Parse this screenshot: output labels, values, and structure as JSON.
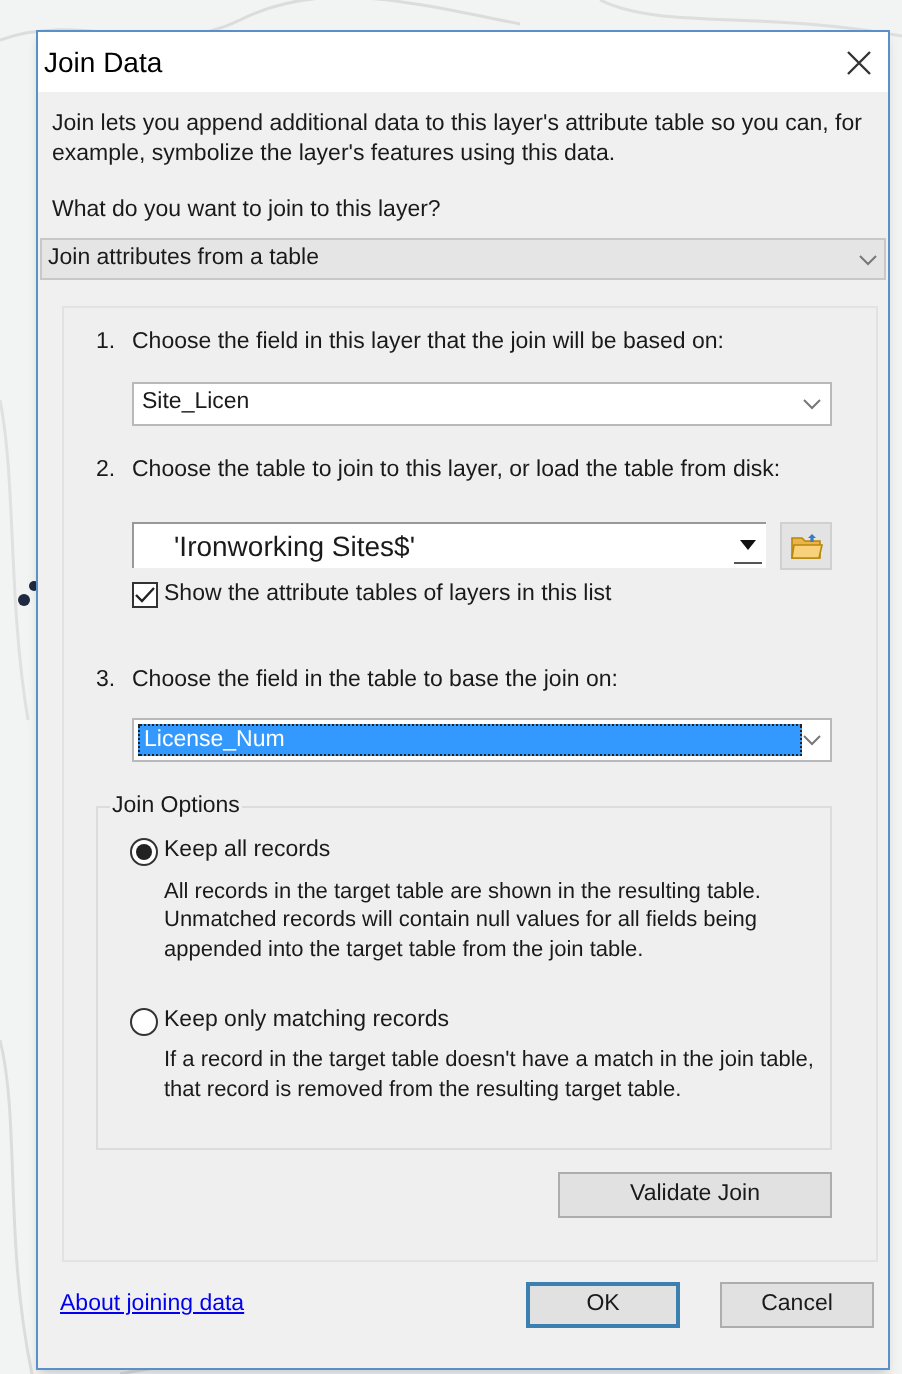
{
  "window": {
    "title": "Join Data"
  },
  "intro": "Join lets you append additional data to this layer's attribute table so you can, for example, symbolize the layer's features using this data.",
  "join_type": {
    "label": "What do you want to join to this layer?",
    "value": "Join attributes from a table"
  },
  "steps": [
    {
      "number": "1.",
      "label": "Choose the field in this layer that the join will be based on:",
      "kind": "dropdown",
      "value": "Site_Licen",
      "highlighted": false
    },
    {
      "number": "2.",
      "label": "Choose the table to join to this layer, or load the table from disk:",
      "kind": "table_picker",
      "value": "'Ironworking Sites$'",
      "checkbox": {
        "label": "Show the attribute tables of layers in this list",
        "checked": true
      }
    },
    {
      "number": "3.",
      "label": "Choose the field in the table to base the join on:",
      "kind": "dropdown",
      "value": "License_Num",
      "highlighted": true
    }
  ],
  "join_options": {
    "title": "Join Options",
    "options": [
      {
        "label": "Keep all records",
        "description": "All records in the target table are shown in the resulting table. Unmatched records will contain null values for all fields being appended into the target table from the join table.",
        "selected": true
      },
      {
        "label": "Keep only matching records",
        "description": "If a record in the target table doesn't have a match in the join table, that record is removed from the resulting target table.",
        "selected": false
      }
    ]
  },
  "validate_button": "Validate Join",
  "help_link": "About joining data",
  "buttons": [
    {
      "label": "OK",
      "default": true
    },
    {
      "label": "Cancel",
      "default": false
    }
  ]
}
